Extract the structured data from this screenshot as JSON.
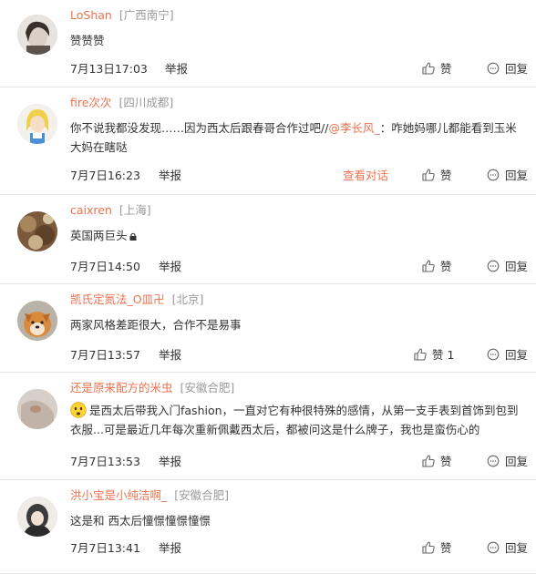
{
  "labels": {
    "report": "举报",
    "like": "赞",
    "reply": "回复",
    "view_conversation": "查看对话"
  },
  "colors": {
    "accent": "#eb7350",
    "muted": "#999999",
    "text": "#333333",
    "divider": "#e6e6e6"
  },
  "comments": [
    {
      "user": "LoShan",
      "location": "[广西南宁]",
      "text": "赞赞赞",
      "time": "7月13日17:03"
    },
    {
      "user": "fire次次",
      "location": "[四川成都]",
      "text_before": "你不说我都没发现……因为西太后跟春哥合作过吧//",
      "mention": "@李长风_",
      "text_after": "：咋她妈哪儿都能看到玉米大妈在瞎哒",
      "time": "7月7日16:23"
    },
    {
      "user": "caixren",
      "location": "[上海]",
      "text": "英国两巨头",
      "time": "7月7日14:50"
    },
    {
      "user": "凯氏定氮法_O皿卍",
      "location": "[北京]",
      "text": "两家风格差距很大，合作不是易事",
      "time": "7月7日13:57",
      "like_count": "1"
    },
    {
      "user": "还是原来配方的米虫",
      "location": "[安徽合肥]",
      "text": "是西太后带我入门fashion，一直对它有种很特殊的感情，从第一支手表到首饰到包到衣服...可是最近几年每次重新佩戴西太后，都被问这是什么牌子，我也是蛮伤心的",
      "time": "7月7日13:53"
    },
    {
      "user": "洪小宝是小纯洁啊_",
      "location": "[安徽合肥]",
      "text": "这是和 西太后憧憬憧憬憧憬",
      "time": "7月7日13:41"
    }
  ]
}
